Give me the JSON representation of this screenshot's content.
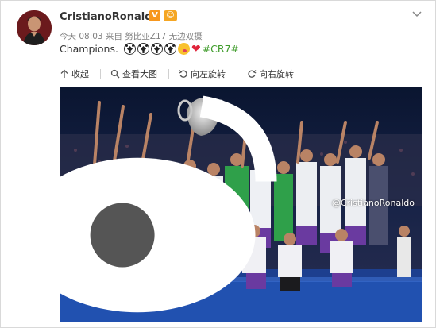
{
  "post": {
    "username": "CristianoRonaldo",
    "verified_badge": "V",
    "meta": "今天 08:03 来自 努比亚Z17 无边双摄",
    "text": "Champions.",
    "hashtag": "#CR7#"
  },
  "toolbar": {
    "collapse": "收起",
    "view_large": "查看大图",
    "rotate_left": "向左旋转",
    "rotate_right": "向右旋转"
  },
  "photo": {
    "watermark": "@CristianoRonaldo"
  },
  "colors": {
    "hashtag": "#3f9c2b",
    "verified": "#f7971e",
    "meta": "#808080"
  }
}
